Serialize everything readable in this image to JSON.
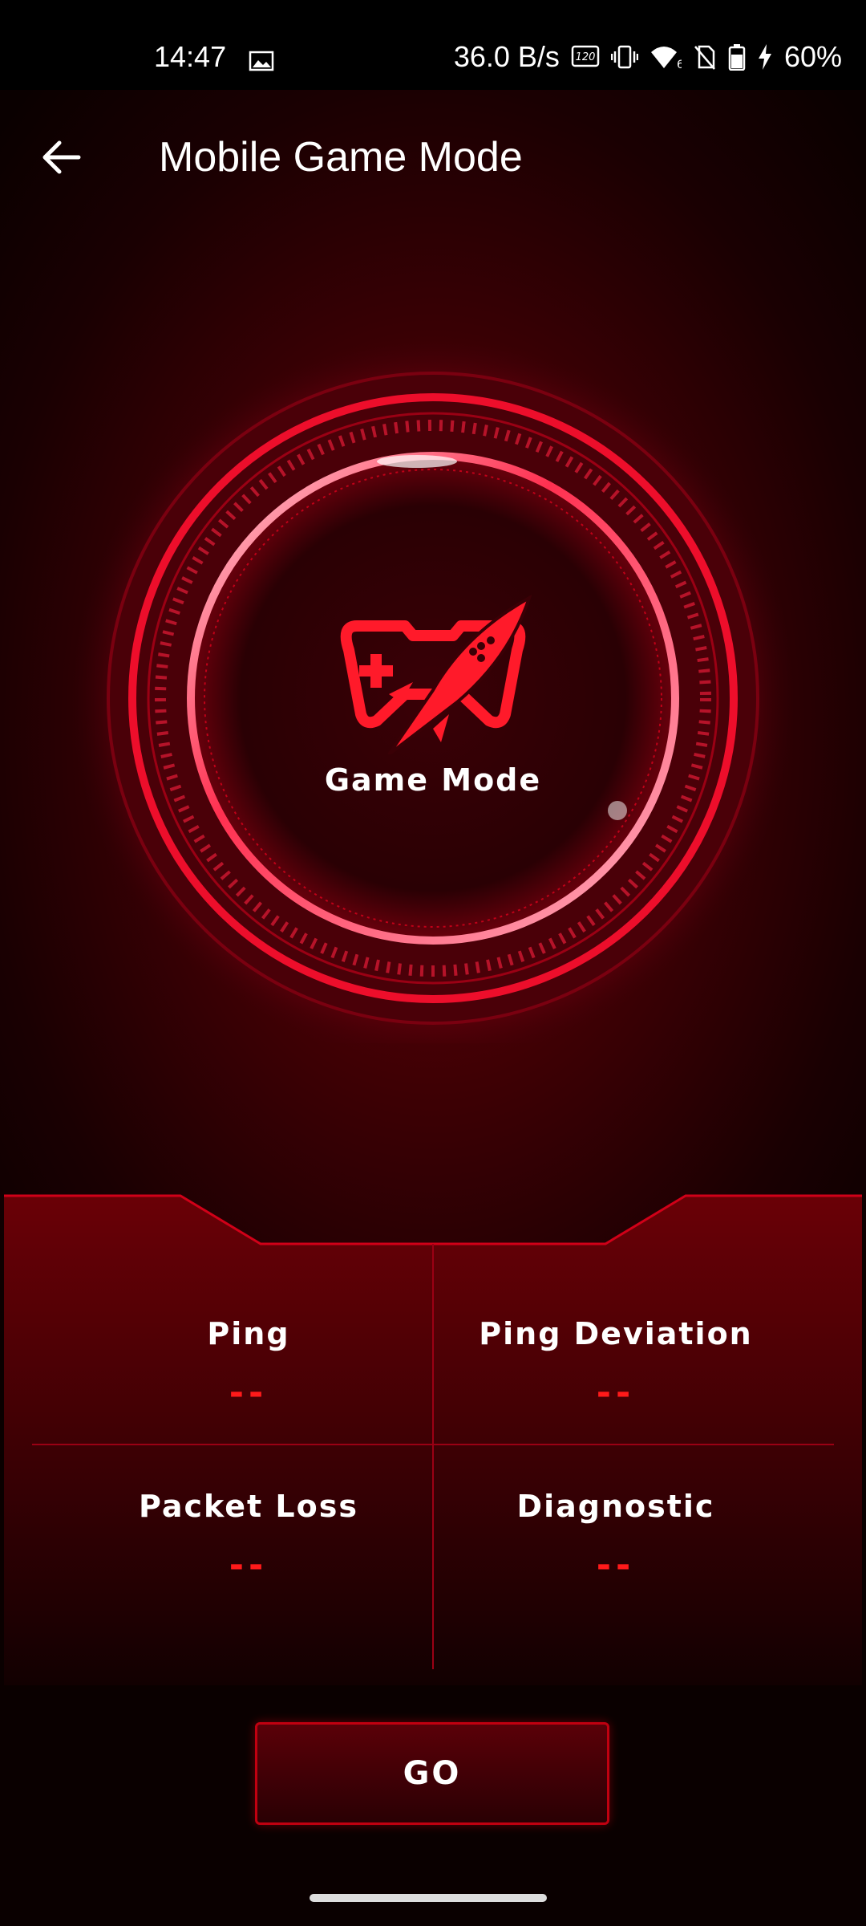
{
  "status_bar": {
    "time": "14:47",
    "net_speed": "36.0 B/s",
    "battery": "60%",
    "icons": [
      "gallery-icon",
      "refresh-120hz-icon",
      "vibrate-icon",
      "wifi-6-icon",
      "no-sim-icon",
      "battery-icon",
      "charging-icon"
    ]
  },
  "header": {
    "title": "Mobile Game Mode",
    "back_icon": "arrow-left-icon"
  },
  "hero": {
    "label": "Game Mode",
    "icon": "game-rocket-icon"
  },
  "stats": [
    {
      "label": "Ping",
      "value": "--"
    },
    {
      "label": "Ping Deviation",
      "value": "--"
    },
    {
      "label": "Packet Loss",
      "value": "--"
    },
    {
      "label": "Diagnostic",
      "value": "--"
    }
  ],
  "actions": {
    "go_label": "GO"
  },
  "colors": {
    "accent": "#ff1a1a",
    "background": "#3a0004"
  }
}
